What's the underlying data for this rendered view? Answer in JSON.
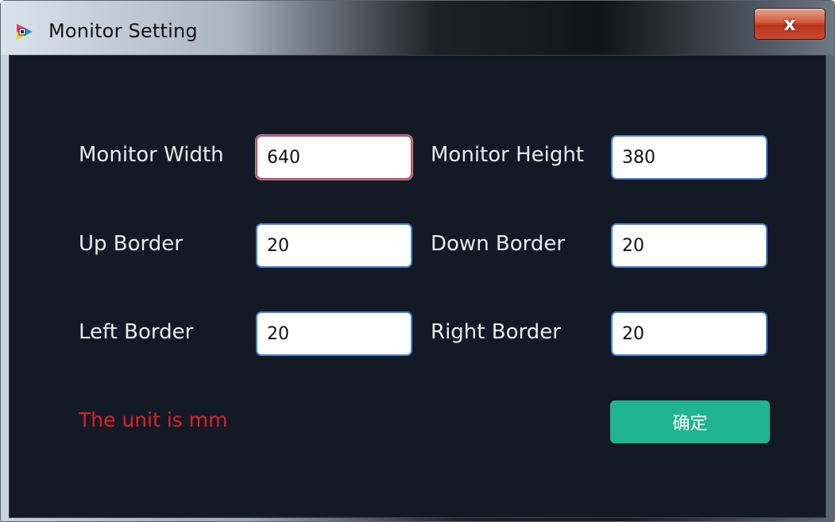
{
  "window": {
    "title": "Monitor Setting",
    "close_label": "x"
  },
  "fields": {
    "monitor_width": {
      "label": "Monitor Width",
      "value": "640"
    },
    "monitor_height": {
      "label": "Monitor Height",
      "value": "380"
    },
    "up_border": {
      "label": "Up Border",
      "value": "20"
    },
    "down_border": {
      "label": "Down Border",
      "value": "20"
    },
    "left_border": {
      "label": "Left Border",
      "value": "20"
    },
    "right_border": {
      "label": "Right Border",
      "value": "20"
    }
  },
  "unit_note": "The unit is mm",
  "confirm_label": "确定",
  "icons": {
    "app": "app-logo-icon",
    "close": "close-icon"
  },
  "colors": {
    "client_bg": "#141a25",
    "input_border": "#4a86d8",
    "focused_border": "#b0566a",
    "note_red": "#e0202a",
    "confirm_green": "#20b48f",
    "close_red": "#c94a2e"
  }
}
